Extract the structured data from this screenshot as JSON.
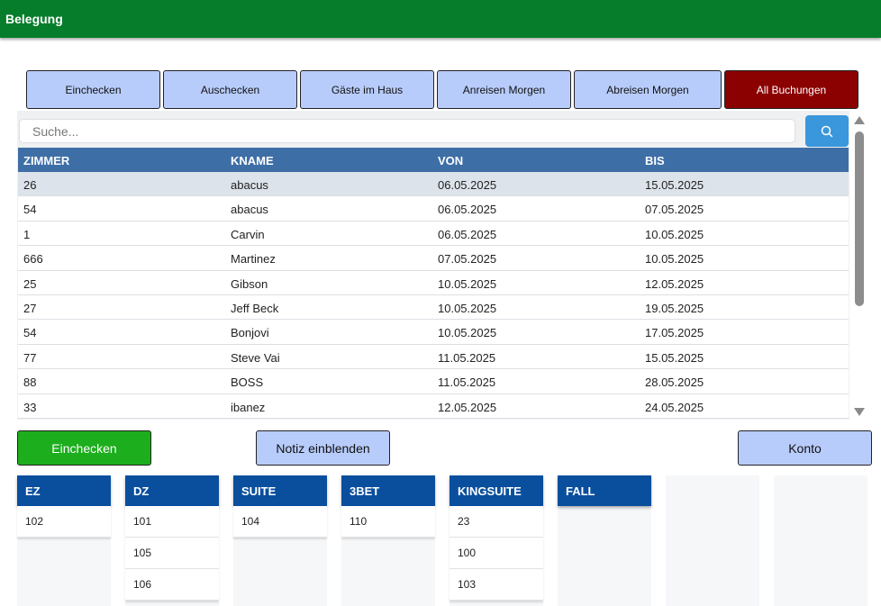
{
  "window": {
    "title": "Belegung"
  },
  "tabs": [
    {
      "label": "Einchecken"
    },
    {
      "label": "Auschecken"
    },
    {
      "label": "Gäste im Haus"
    },
    {
      "label": "Anreisen Morgen"
    },
    {
      "label": "Abreisen Morgen"
    },
    {
      "label": "All Buchungen"
    }
  ],
  "search": {
    "placeholder": "Suche...",
    "icon": "search-icon"
  },
  "table": {
    "columns": [
      "ZIMMER",
      "KNAME",
      "VON",
      "BIS"
    ],
    "rows": [
      [
        "26",
        "abacus",
        "06.05.2025",
        "15.05.2025"
      ],
      [
        "54",
        "abacus",
        "06.05.2025",
        "07.05.2025"
      ],
      [
        "1",
        "Carvin",
        "06.05.2025",
        "10.05.2025"
      ],
      [
        "666",
        "Martinez",
        "07.05.2025",
        "10.05.2025"
      ],
      [
        "25",
        "Gibson",
        "10.05.2025",
        "12.05.2025"
      ],
      [
        "27",
        "Jeff Beck",
        "10.05.2025",
        "19.05.2025"
      ],
      [
        "54",
        "Bonjovi",
        "10.05.2025",
        "17.05.2025"
      ],
      [
        "77",
        "Steve Vai",
        "11.05.2025",
        "15.05.2025"
      ],
      [
        "88",
        "BOSS",
        "11.05.2025",
        "28.05.2025"
      ],
      [
        "33",
        "ibanez",
        "12.05.2025",
        "24.05.2025"
      ]
    ]
  },
  "actions": {
    "checkin": "Einchecken",
    "notiz": "Notiz einblenden",
    "konto": "Konto"
  },
  "room_types": [
    {
      "name": "EZ",
      "rooms": [
        "102"
      ]
    },
    {
      "name": "DZ",
      "rooms": [
        "101",
        "105",
        "106"
      ]
    },
    {
      "name": "SUITE",
      "rooms": [
        "104"
      ]
    },
    {
      "name": "3BET",
      "rooms": [
        "110"
      ]
    },
    {
      "name": "KINGSUITE",
      "rooms": [
        "23",
        "100",
        "103"
      ]
    },
    {
      "name": "FALL",
      "rooms": []
    },
    {
      "name": "",
      "rooms": []
    },
    {
      "name": "",
      "rooms": []
    }
  ],
  "colors": {
    "titlebar": "#067d2a",
    "tab": "#b8ccfb",
    "tab_active": "#8b0000",
    "table_header": "#3e6ea6",
    "column_header": "#0a4f9e",
    "checkin_button": "#1cae1c"
  }
}
